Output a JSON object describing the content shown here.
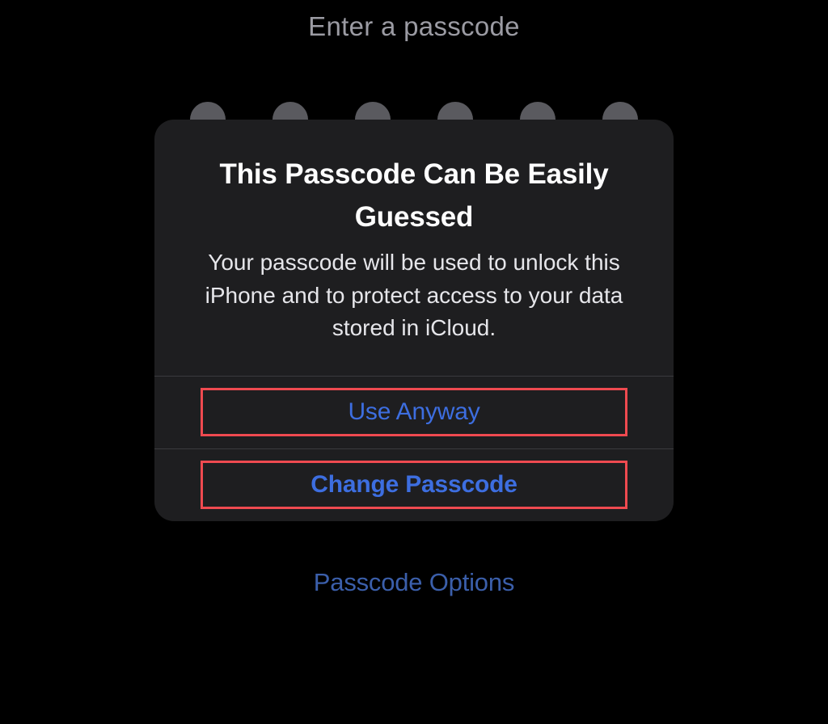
{
  "page": {
    "title": "Enter a passcode"
  },
  "alert": {
    "title": "This Passcode Can Be Easily Guessed",
    "message": "Your passcode will be used to unlock this iPhone and to protect access to your data stored in iCloud.",
    "buttons": {
      "use_anyway": "Use Anyway",
      "change_passcode": "Change Passcode"
    }
  },
  "options": {
    "passcode_options": "Passcode Options"
  }
}
